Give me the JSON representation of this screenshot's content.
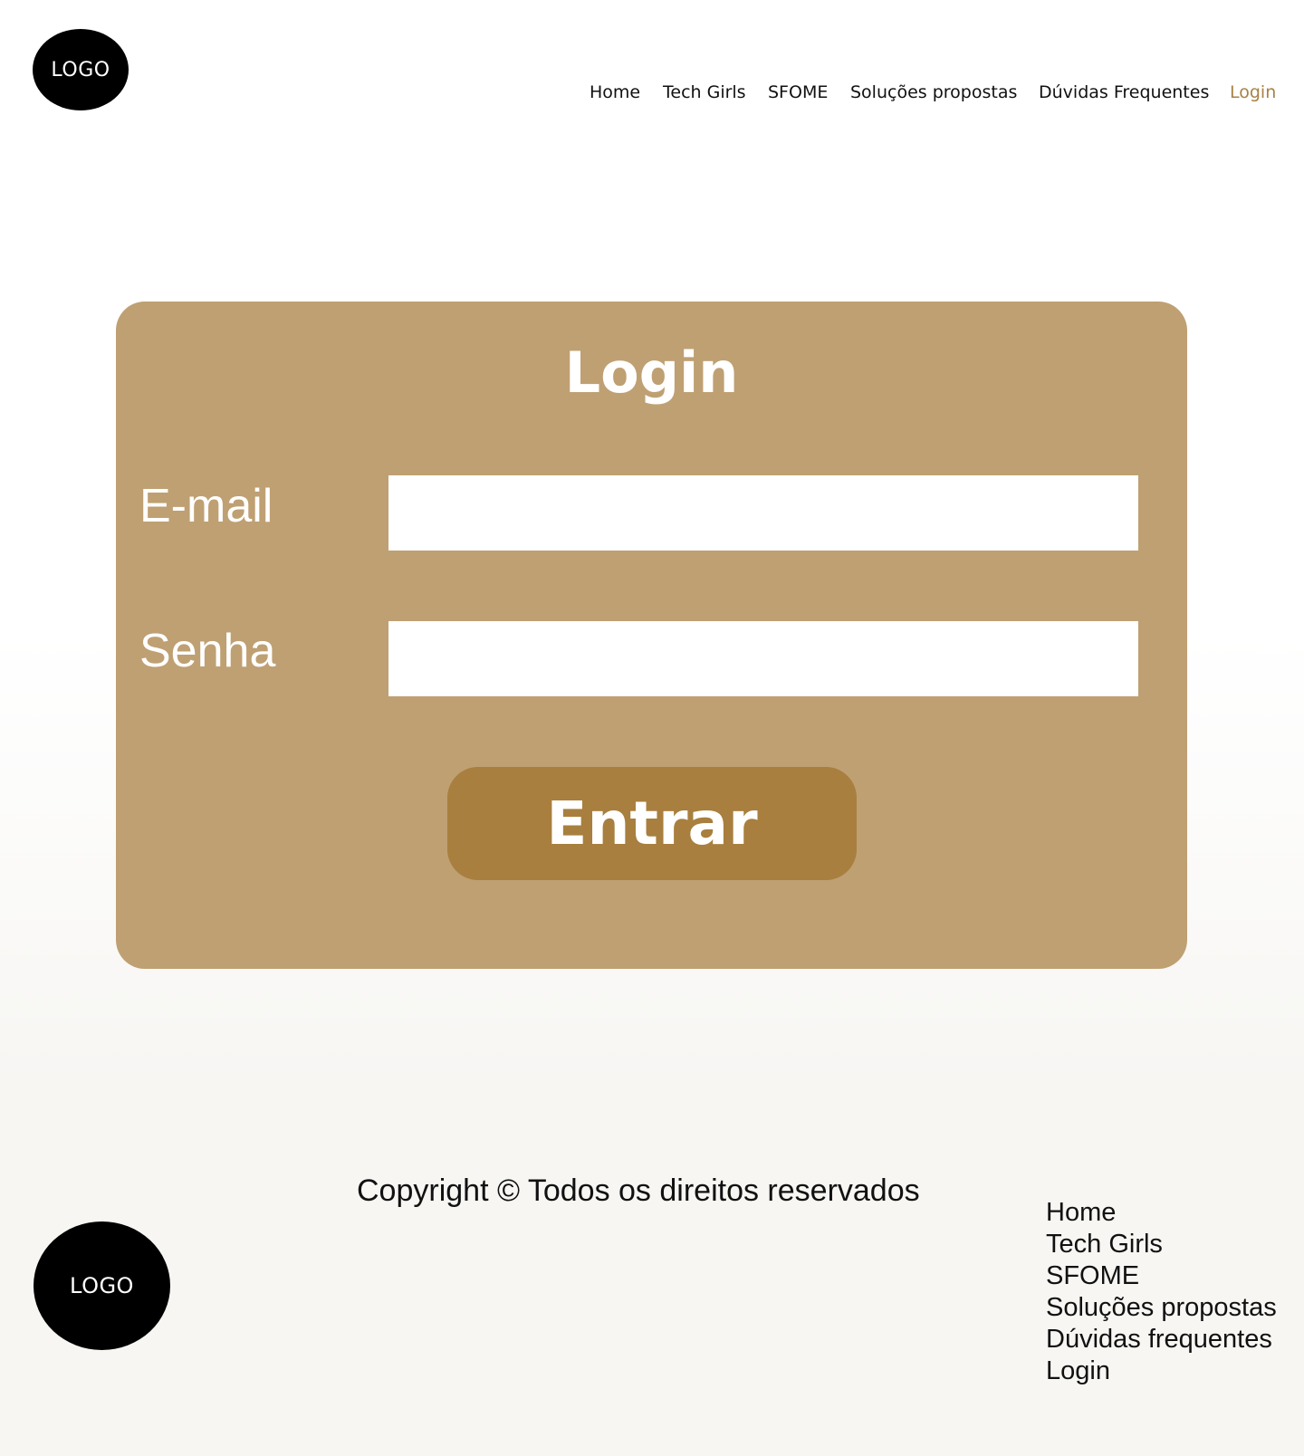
{
  "header": {
    "logo_text": "LOGO",
    "nav": [
      {
        "label": "Home"
      },
      {
        "label": "Tech Girls"
      },
      {
        "label": "SFOME"
      },
      {
        "label": "Soluções propostas"
      },
      {
        "label": "Dúvidas Frequentes"
      },
      {
        "label": "Login",
        "active": true
      }
    ]
  },
  "login": {
    "title": "Login",
    "email_label": "E-mail",
    "email_value": "",
    "password_label": "Senha",
    "password_value": "",
    "submit_label": "Entrar"
  },
  "footer": {
    "copyright": "Copyright © Todos os direitos reservados",
    "logo_text": "LOGO",
    "links": [
      {
        "label": "Home"
      },
      {
        "label": "Tech Girls"
      },
      {
        "label": "SFOME"
      },
      {
        "label": "Soluções propostas"
      },
      {
        "label": "Dúvidas frequentes"
      },
      {
        "label": "Login"
      }
    ]
  },
  "colors": {
    "card_background": "#bfa073",
    "button_background": "#a87f3e",
    "active_nav": "#a88245",
    "logo_background": "#000000"
  }
}
